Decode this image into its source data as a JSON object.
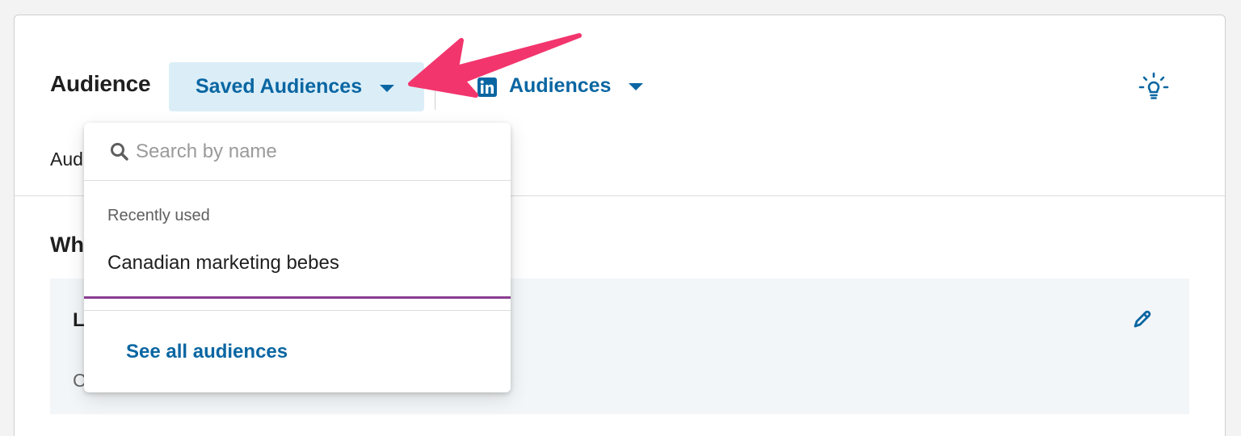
{
  "header": {
    "title": "Audience",
    "saved_audiences_label": "Saved Audiences",
    "audiences_label": "Audiences",
    "linkedin_icon": "linkedin-icon",
    "lightbulb_icon": "lightbulb-icon"
  },
  "content": {
    "sub_label": "Aud",
    "section_heading": "Wh",
    "panel_title": "L",
    "panel_subtitle": "C",
    "edit_icon": "pencil-icon"
  },
  "dropdown": {
    "search_placeholder": "Search by name",
    "search_icon": "search-icon",
    "recent_heading": "Recently used",
    "recent_items": [
      "Canadian marketing bebes"
    ],
    "see_all_label": "See all audiences"
  },
  "colors": {
    "accent_blue": "#0a66a2",
    "button_highlight": "#dbeef8",
    "selected_underline": "#8a3d91",
    "annotation_arrow": "#f2356d"
  }
}
